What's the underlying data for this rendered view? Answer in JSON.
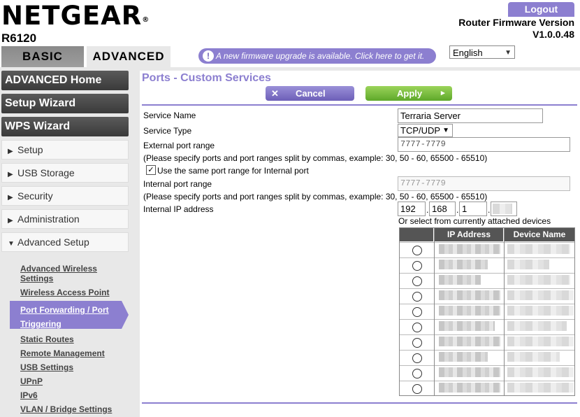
{
  "header": {
    "brand": "NETGEAR",
    "registered_mark": "®",
    "model": "R6120",
    "logout_label": "Logout",
    "firmware_label": "Router Firmware Version",
    "firmware_version": "V1.0.0.48"
  },
  "tabs": [
    {
      "label": "BASIC",
      "active": false
    },
    {
      "label": "ADVANCED",
      "active": true
    }
  ],
  "notice": {
    "icon": "!",
    "text": "A new firmware upgrade is available. Click here to get it."
  },
  "language": {
    "selected": "English"
  },
  "sidebar": {
    "buttons": [
      "ADVANCED Home",
      "Setup Wizard",
      "WPS Wizard"
    ],
    "menus": [
      {
        "label": "Setup",
        "expanded": false
      },
      {
        "label": "USB Storage",
        "expanded": false
      },
      {
        "label": "Security",
        "expanded": false
      },
      {
        "label": "Administration",
        "expanded": false
      },
      {
        "label": "Advanced Setup",
        "expanded": true
      }
    ],
    "submenu": [
      {
        "line1": "Advanced Wireless",
        "line2": "Settings"
      },
      {
        "line1": "Wireless Access Point"
      },
      {
        "line1": "Port Forwarding / Port",
        "line2": "Triggering",
        "active": true
      },
      {
        "line1": "Static Routes"
      },
      {
        "line1": "Remote Management"
      },
      {
        "line1": "USB Settings"
      },
      {
        "line1": "UPnP"
      },
      {
        "line1": "IPv6"
      },
      {
        "line1": "VLAN / Bridge Settings"
      }
    ]
  },
  "main": {
    "title": "Ports - Custom Services",
    "cancel_label": "Cancel",
    "cancel_icon": "✕",
    "apply_label": "Apply",
    "apply_icon": "▸",
    "service_name_label": "Service Name",
    "service_name_value": "Terraria Server",
    "service_type_label": "Service Type",
    "service_type_value": "TCP/UDP",
    "external_port_label": "External port range",
    "external_port_value": "7777-7779",
    "port_hint": "(Please specify ports and port ranges split by commas, example: 30, 50 - 60, 65500 - 65510)",
    "same_range_label": "Use the same port range for Internal port",
    "same_range_checked": true,
    "internal_port_label": "Internal port range",
    "internal_port_value": "7777-7779",
    "internal_ip_label": "Internal IP address",
    "ip": [
      "192",
      "168",
      "1",
      ""
    ],
    "select_devices_label": "Or select from currently attached devices",
    "table": {
      "headers": [
        "IP Address",
        "Device Name"
      ],
      "row_count": 10
    }
  }
}
